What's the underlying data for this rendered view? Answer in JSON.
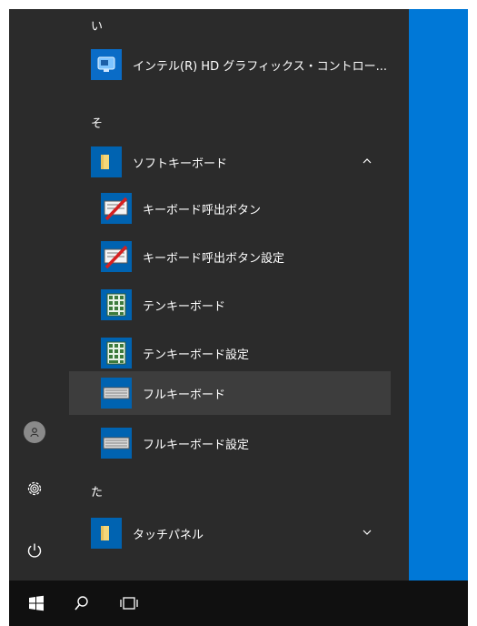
{
  "colors": {
    "menu_bg": "#2b2b2b",
    "tile_bg": "#0078d7",
    "icon_bg": "#0063b1",
    "hover_bg": "#3d3d3d",
    "taskbar_bg": "#101010"
  },
  "sections": [
    {
      "letter": "い"
    },
    {
      "letter": "そ"
    },
    {
      "letter": "た"
    }
  ],
  "apps": [
    {
      "label": "インテル(R) HD グラフィックス・コントロー...",
      "icon": "intel-graphics-icon"
    },
    {
      "label": "ソフトキーボード",
      "icon": "folder-icon",
      "expanded": true
    },
    {
      "label": "キーボード呼出ボタン",
      "icon": "keyboard-call-button-icon"
    },
    {
      "label": "キーボード呼出ボタン設定",
      "icon": "keyboard-call-button-settings-icon"
    },
    {
      "label": "テンキーボード",
      "icon": "numpad-icon"
    },
    {
      "label": "テンキーボード設定",
      "icon": "numpad-settings-icon"
    },
    {
      "label": "フルキーボード",
      "icon": "full-keyboard-icon",
      "hovered": true
    },
    {
      "label": "フルキーボード設定",
      "icon": "full-keyboard-settings-icon"
    },
    {
      "label": "タッチパネル",
      "icon": "folder-icon",
      "expanded": false
    }
  ],
  "rail": {
    "items": [
      "user-avatar-icon",
      "settings-icon",
      "power-icon"
    ]
  },
  "taskbar": {
    "items": [
      "windows-start-icon",
      "search-icon",
      "task-view-icon"
    ]
  }
}
